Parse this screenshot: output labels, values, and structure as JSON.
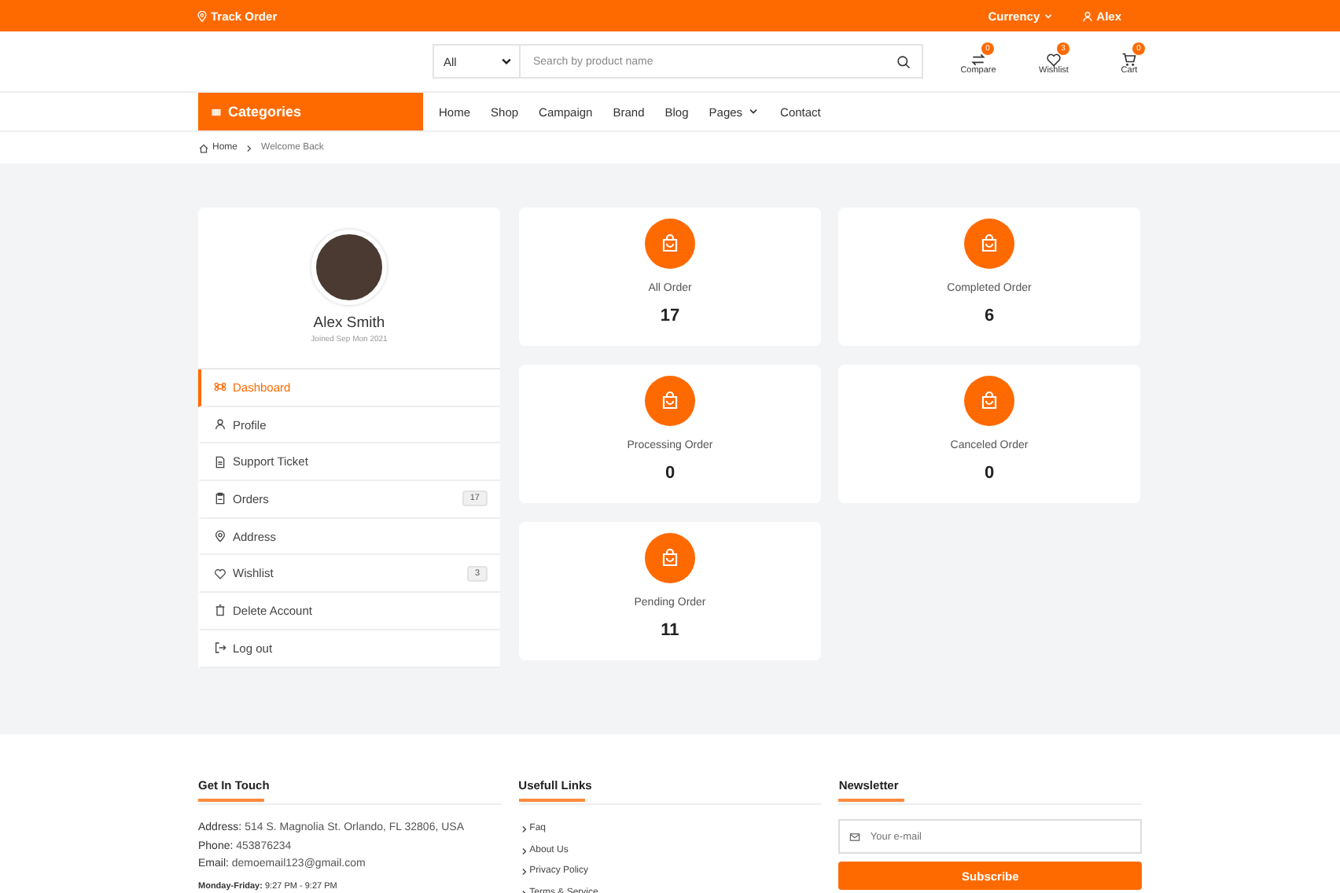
{
  "topbar": {
    "track_order": "Track Order",
    "currency": "Currency",
    "user": "Alex"
  },
  "header": {
    "category_select": "All",
    "search": {
      "placeholder": "Search by product name"
    },
    "actions": [
      {
        "kind": "compare",
        "label": "Compare",
        "count": "0"
      },
      {
        "kind": "wishlist",
        "label": "Wishlist",
        "count": "3"
      },
      {
        "kind": "cart",
        "label": "Cart",
        "count": "0"
      }
    ]
  },
  "nav": {
    "categories": "Categories",
    "links": [
      {
        "label": "Home",
        "dropdown": false
      },
      {
        "label": "Shop",
        "dropdown": false
      },
      {
        "label": "Campaign",
        "dropdown": false
      },
      {
        "label": "Brand",
        "dropdown": false
      },
      {
        "label": "Blog",
        "dropdown": false
      },
      {
        "label": "Pages",
        "dropdown": true
      },
      {
        "label": "Contact",
        "dropdown": false
      }
    ]
  },
  "breadcrumb": [
    "Home",
    "Welcome Back"
  ],
  "profile": {
    "name": "Alex Smith",
    "joined": "Joined Sep Mon 2021"
  },
  "menu": [
    {
      "kind": "dashboard",
      "label": "Dashboard",
      "selected": true
    },
    {
      "kind": "profile",
      "label": "Profile",
      "selected": false
    },
    {
      "kind": "ticket",
      "label": "Support Ticket",
      "selected": false
    },
    {
      "kind": "orders",
      "label": "Orders",
      "selected": false,
      "badge": "17"
    },
    {
      "kind": "address",
      "label": "Address",
      "selected": false
    },
    {
      "kind": "wishlist",
      "label": "Wishlist",
      "selected": false,
      "badge": "3"
    },
    {
      "kind": "delete",
      "label": "Delete Account",
      "selected": false
    },
    {
      "kind": "logout",
      "label": "Log out",
      "selected": false
    }
  ],
  "stats": [
    {
      "label": "All Order",
      "value": "17"
    },
    {
      "label": "Completed Order",
      "value": "6"
    },
    {
      "label": "Processing Order",
      "value": "0"
    },
    {
      "label": "Canceled Order",
      "value": "0"
    },
    {
      "label": "Pending Order",
      "value": "11"
    }
  ],
  "footer": {
    "contact": {
      "title": "Get In Touch",
      "lines": [
        {
          "label": "Address:",
          "value": "514 S. Magnolia St. Orlando, FL 32806, USA"
        },
        {
          "label": "Phone:",
          "value": "453876234"
        },
        {
          "label": "Email:",
          "value": "demoemail123@gmail.com"
        }
      ],
      "hours": {
        "label": "Monday-Friday:",
        "value": "9:27 PM - 9:27 PM"
      }
    },
    "links": {
      "title": "Usefull Links",
      "items": [
        "Faq",
        "About Us",
        "Privacy Policy",
        "Terms & Service"
      ]
    },
    "newsletter": {
      "title": "Newsletter",
      "placeholder": "Your e-mail",
      "button": "Subscribe"
    }
  }
}
